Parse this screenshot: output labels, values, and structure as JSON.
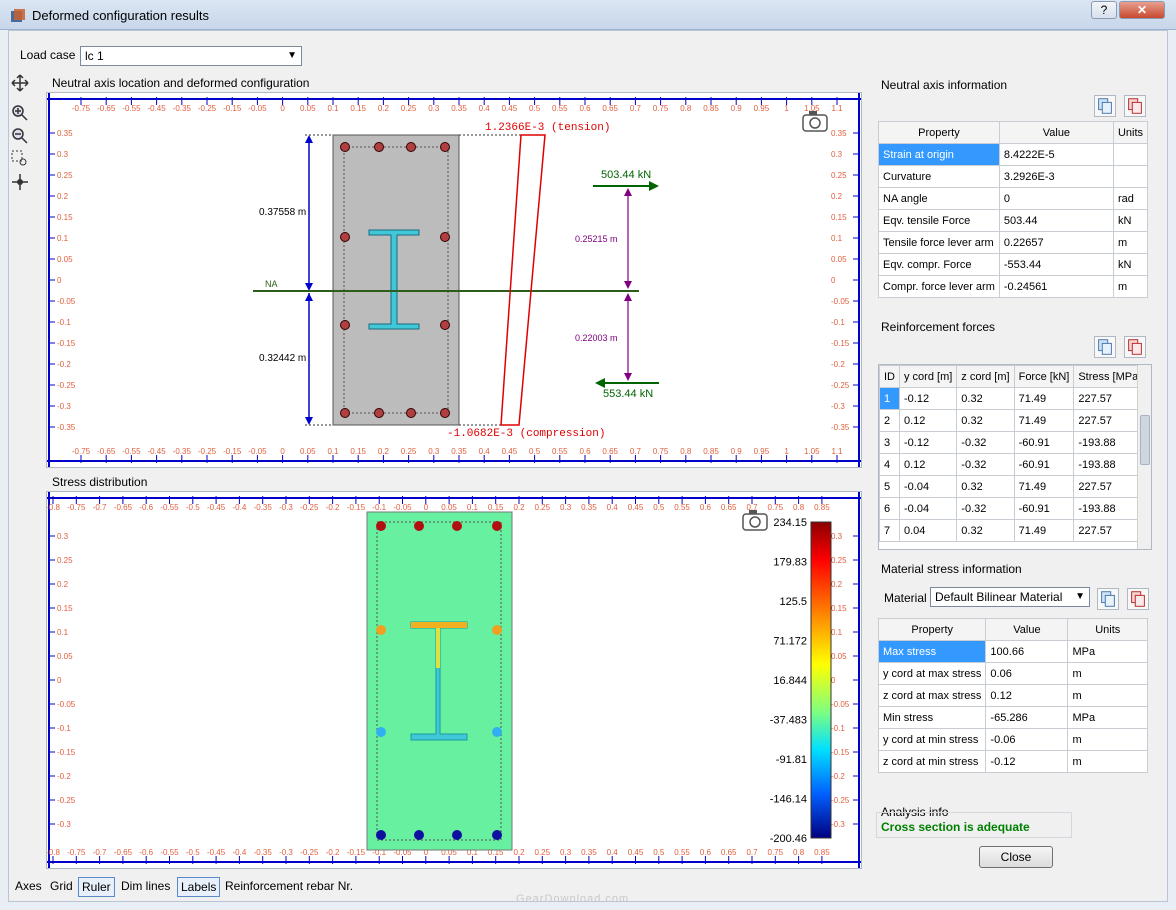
{
  "window": {
    "title": "Deformed configuration results",
    "help_label": "?",
    "close_label": "✕"
  },
  "load_case": {
    "label": "Load case",
    "value": "lc 1"
  },
  "na_plot": {
    "title": "Neutral axis location and deformed configuration",
    "x_ticks": [
      "-0.75",
      "-0.65",
      "-0.55",
      "-0.45",
      "-0.35",
      "-0.25",
      "-0.15",
      "-0.05",
      "0",
      "0.05",
      "0.1",
      "0.15",
      "0.2",
      "0.25",
      "0.3",
      "0.35",
      "0.4",
      "0.45",
      "0.5",
      "0.55",
      "0.6",
      "0.65",
      "0.7",
      "0.75",
      "0.8",
      "0.85",
      "0.9",
      "0.95",
      "1",
      "1.05",
      "1.1"
    ],
    "y_ticks": [
      "0.35",
      "0.3",
      "0.25",
      "0.2",
      "0.15",
      "0.1",
      "0.05",
      "0",
      "-0.05",
      "-0.1",
      "-0.15",
      "-0.2",
      "-0.25",
      "-0.3",
      "-0.35"
    ],
    "dim_top": "0.37558 m",
    "dim_bottom": "0.32442 m",
    "na_label": "NA",
    "tension_label": "1.2366E-3 (tension)",
    "compression_label": "-1.0682E-3 (compression)",
    "tensile_force": "503.44 kN",
    "compr_force": "553.44 kN",
    "lever_top": "0.25215 m",
    "lever_bottom": "0.22003 m"
  },
  "stress_plot": {
    "title": "Stress distribution",
    "x_ticks": [
      "-0.8",
      "-0.75",
      "-0.7",
      "-0.65",
      "-0.6",
      "-0.55",
      "-0.5",
      "-0.45",
      "-0.4",
      "-0.35",
      "-0.3",
      "-0.25",
      "-0.2",
      "-0.15",
      "-0.1",
      "-0.05",
      "0",
      "0.05",
      "0.1",
      "0.15",
      "0.2",
      "0.25",
      "0.3",
      "0.35",
      "0.4",
      "0.45",
      "0.5",
      "0.55",
      "0.6",
      "0.65",
      "0.7",
      "0.75",
      "0.8",
      "0.85"
    ],
    "y_ticks": [
      "0.3",
      "0.25",
      "0.2",
      "0.15",
      "0.1",
      "0.05",
      "0",
      "-0.05",
      "-0.1",
      "-0.15",
      "-0.2",
      "-0.25",
      "-0.3"
    ],
    "legend_values": [
      "234.15",
      "179.83",
      "125.5",
      "71.172",
      "16.844",
      "-37.483",
      "-91.81",
      "-146.14",
      "-200.46"
    ]
  },
  "neutral_axis_info": {
    "title": "Neutral axis information",
    "headers": [
      "Property",
      "Value",
      "Units"
    ],
    "rows": [
      [
        "Strain at origin",
        "8.4222E-5",
        ""
      ],
      [
        "Curvature",
        "3.2926E-3",
        ""
      ],
      [
        "NA angle",
        "0",
        "rad"
      ],
      [
        "Eqv. tensile Force",
        "503.44",
        "kN"
      ],
      [
        "Tensile force lever arm",
        "0.22657",
        "m"
      ],
      [
        "Eqv. compr. Force",
        "-553.44",
        "kN"
      ],
      [
        "Compr. force lever arm",
        "-0.24561",
        "m"
      ]
    ]
  },
  "reinforcement_forces": {
    "title": "Reinforcement forces",
    "headers": [
      "ID",
      "y cord [m]",
      "z cord [m]",
      "Force [kN]",
      "Stress [MPa]"
    ],
    "rows": [
      [
        "1",
        "-0.12",
        "0.32",
        "71.49",
        "227.57"
      ],
      [
        "2",
        "0.12",
        "0.32",
        "71.49",
        "227.57"
      ],
      [
        "3",
        "-0.12",
        "-0.32",
        "-60.91",
        "-193.88"
      ],
      [
        "4",
        "0.12",
        "-0.32",
        "-60.91",
        "-193.88"
      ],
      [
        "5",
        "-0.04",
        "0.32",
        "71.49",
        "227.57"
      ],
      [
        "6",
        "-0.04",
        "-0.32",
        "-60.91",
        "-193.88"
      ],
      [
        "7",
        "0.04",
        "0.32",
        "71.49",
        "227.57"
      ]
    ]
  },
  "material_stress": {
    "title": "Material stress information",
    "material_label": "Material",
    "material_value": "Default Bilinear Material",
    "headers": [
      "Property",
      "Value",
      "Units"
    ],
    "rows": [
      [
        "Max stress",
        "100.66",
        "MPa"
      ],
      [
        "y cord at max stress",
        "0.06",
        "m"
      ],
      [
        "z cord at max stress",
        "0.12",
        "m"
      ],
      [
        "Min stress",
        "-65.286",
        "MPa"
      ],
      [
        "y cord at min stress",
        "-0.06",
        "m"
      ],
      [
        "z cord at min stress",
        "-0.12",
        "m"
      ]
    ]
  },
  "analysis": {
    "title": "Analysis info",
    "status": "Cross section is adequate"
  },
  "close_button": "Close",
  "bottom_toggles": [
    "Axes",
    "Grid",
    "Ruler",
    "Dim lines",
    "Labels",
    "Reinforcement rebar Nr."
  ],
  "watermark": "GearDownload.com",
  "colors": {
    "selection": "#3399ff",
    "section_gray": "#c0c0c0",
    "concrete_stress": "#66f0a0",
    "steel_profile": "#40c8d8",
    "tension": "#e00000",
    "force_arrow": "#006400",
    "na_line": "#2e5c1a",
    "lever": "#800080",
    "dim": "#0000cc"
  }
}
